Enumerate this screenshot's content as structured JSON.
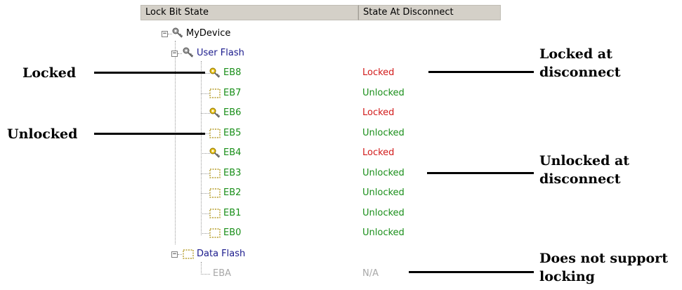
{
  "columns": [
    "Lock Bit State",
    "State At Disconnect"
  ],
  "tree": {
    "root": "MyDevice",
    "user_flash": "User Flash",
    "data_flash": "Data Flash",
    "blocks": [
      {
        "name": "EB8",
        "state": "Locked",
        "locked": true
      },
      {
        "name": "EB7",
        "state": "Unlocked",
        "locked": false
      },
      {
        "name": "EB6",
        "state": "Locked",
        "locked": true
      },
      {
        "name": "EB5",
        "state": "Unlocked",
        "locked": false
      },
      {
        "name": "EB4",
        "state": "Locked",
        "locked": true
      },
      {
        "name": "EB3",
        "state": "Unlocked",
        "locked": false
      },
      {
        "name": "EB2",
        "state": "Unlocked",
        "locked": false
      },
      {
        "name": "EB1",
        "state": "Unlocked",
        "locked": false
      },
      {
        "name": "EB0",
        "state": "Unlocked",
        "locked": false
      }
    ],
    "data_block": {
      "name": "EBA",
      "state": "N/A"
    }
  },
  "annotations": {
    "locked": "Locked",
    "unlocked": "Unlocked",
    "locked_at_disconnect": [
      "Locked at",
      "disconnect"
    ],
    "unlocked_at_disconnect": [
      "Unlocked at",
      "disconnect"
    ],
    "no_locking": [
      "Does not support",
      "locking"
    ]
  },
  "colors": {
    "locked_text": "#d21a1a",
    "unlocked_text": "#1a8f1a",
    "folder_text": "#1a1a8c",
    "disabled_text": "#a8a8a8",
    "key_icon": "#e8c21a"
  }
}
